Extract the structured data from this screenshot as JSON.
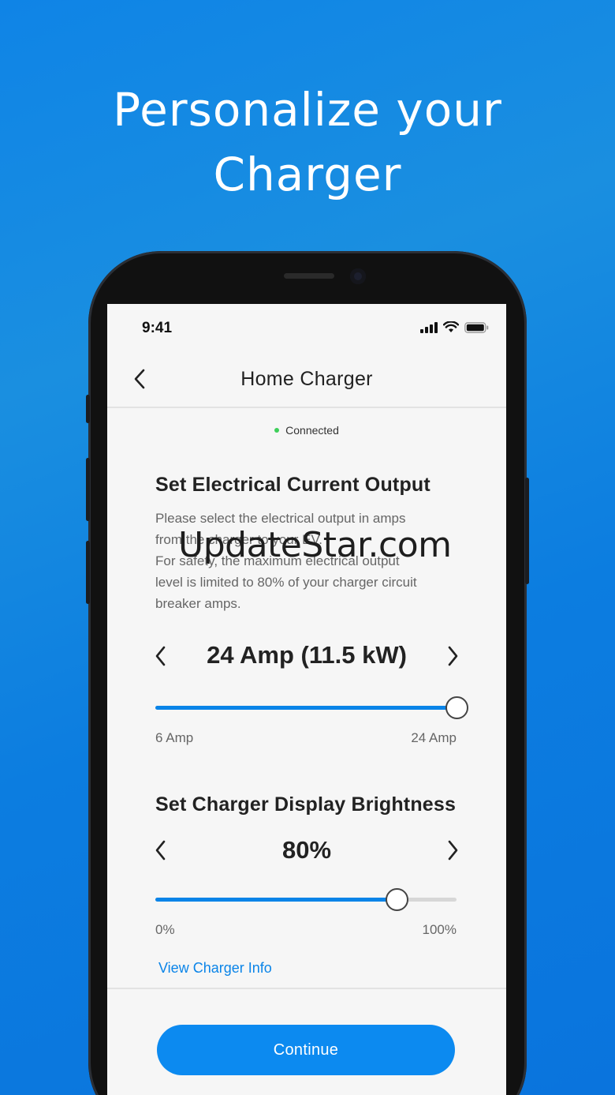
{
  "headline": {
    "line1": "Personalize your",
    "line2": "Charger"
  },
  "status_bar": {
    "time": "9:41"
  },
  "nav": {
    "title": "Home Charger"
  },
  "connection": {
    "status": "Connected"
  },
  "current_output": {
    "title": "Set Electrical Current Output",
    "desc_line1": "Please select the electrical output in amps",
    "desc_line2": "from the charger to your EV.",
    "desc_line3": "For safety, the maximum electrical output",
    "desc_line4": "level is limited to 80% of your charger circuit",
    "desc_line5": "breaker amps.",
    "value": "24 Amp (11.5 kW)",
    "min_label": "6 Amp",
    "max_label": "24 Amp",
    "slider_fraction": 1.0
  },
  "brightness": {
    "title": "Set Charger Display Brightness",
    "value": "80%",
    "min_label": "0%",
    "max_label": "100%",
    "slider_fraction": 0.8
  },
  "links": {
    "view_info": "View Charger Info"
  },
  "footer": {
    "continue_label": "Continue"
  },
  "watermark": "UpdateStar.com",
  "colors": {
    "accent": "#0a84e8",
    "connected": "#3ecf5a",
    "background": "#0f84e6"
  }
}
